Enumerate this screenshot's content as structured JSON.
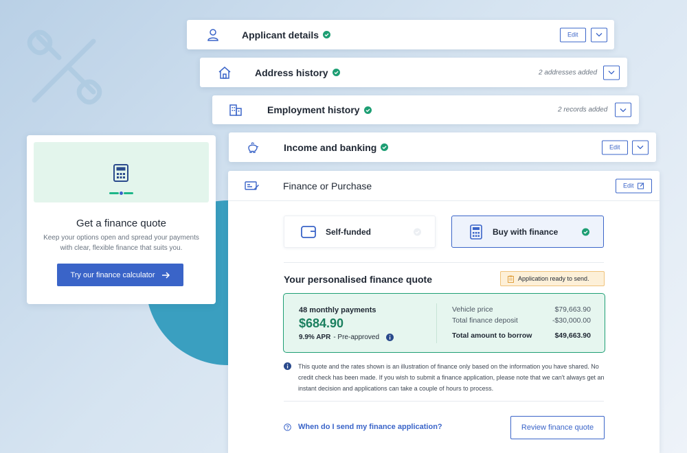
{
  "quote_card": {
    "title": "Get a finance quote",
    "description": "Keep your options open and spread your payments with clear, flexible finance that suits you.",
    "button_label": "Try our finance calculator",
    "button_icon": "arrow-right-icon",
    "hero_icon": "calculator-icon"
  },
  "sections": {
    "applicant": {
      "title": "Applicant details",
      "edit_label": "Edit",
      "icon": "user-icon",
      "status": "complete"
    },
    "address": {
      "title": "Address history",
      "meta": "2 addresses added",
      "icon": "home-icon",
      "status": "complete"
    },
    "employment": {
      "title": "Employment history",
      "meta": "2 records added",
      "icon": "building-icon",
      "status": "complete"
    },
    "income": {
      "title": "Income and banking",
      "edit_label": "Edit",
      "icon": "piggy-bank-icon",
      "status": "complete"
    }
  },
  "finance": {
    "title": "Finance or Purchase",
    "edit_label": "Edit",
    "icon": "cheque-icon",
    "options": {
      "self_funded": {
        "label": "Self-funded",
        "icon": "wallet-icon",
        "selected": false
      },
      "buy_finance": {
        "label": "Buy with finance",
        "icon": "calculator-icon",
        "selected": true
      }
    },
    "quote_title": "Your personalised finance quote",
    "ready_badge": "Application ready to send.",
    "quote": {
      "months_label": "48 monthly payments",
      "monthly_amount": "$684.90",
      "apr": "9.9% APR",
      "apr_note": "- Pre-approved",
      "rows": [
        {
          "label": "Vehicle price",
          "value": "$79,663.90"
        },
        {
          "label": "Total finance deposit",
          "value": "-$30,000.00"
        }
      ],
      "total_label": "Total amount to borrow",
      "total_value": "$49,663.90"
    },
    "disclaimer": "This quote and the rates shown is an illustration of finance only based on the information you have shared. No credit check has been made. If you wish to submit a finance application, please note that we can't always get an instant decision and applications can take a couple of hours to process.",
    "faq_link": "When do I send my finance application?",
    "review_button": "Review finance quote"
  },
  "colors": {
    "accent": "#3a64c8",
    "success": "#1d9e73",
    "amount": "#1a7f5e",
    "warning_bg": "#fdf0d8",
    "teal_circle": "#3a9fc0"
  }
}
